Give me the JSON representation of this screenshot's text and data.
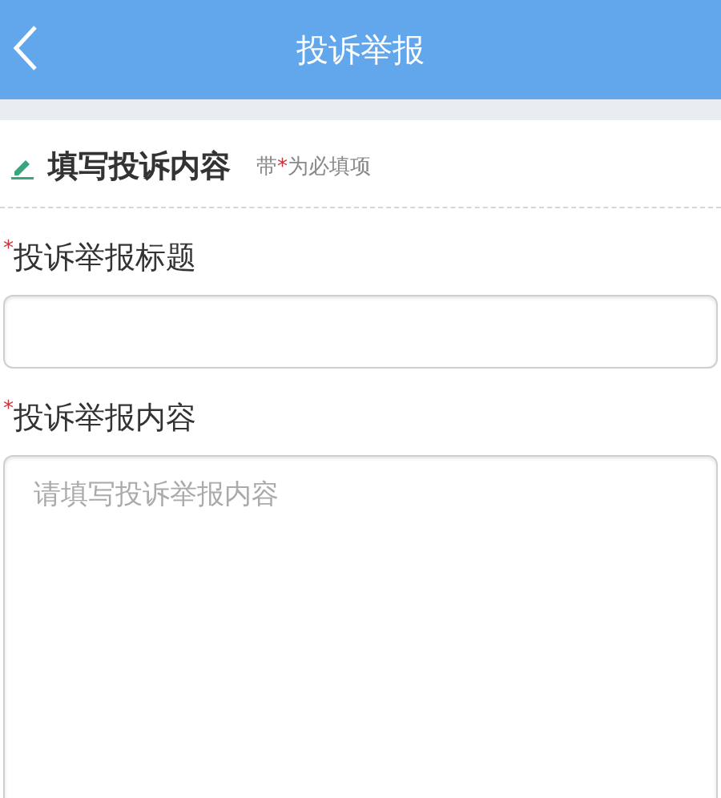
{
  "header": {
    "title": "投诉举报"
  },
  "section": {
    "title": "填写投诉内容",
    "hint": {
      "before": "带",
      "mark": "*",
      "after": "为必填项"
    }
  },
  "fields": [
    {
      "kind": "input",
      "mark": "*",
      "label": "投诉举报标题"
    },
    {
      "kind": "textarea",
      "mark": "*",
      "label": "投诉举报内容",
      "placeholder": "请填写投诉举报内容"
    }
  ]
}
